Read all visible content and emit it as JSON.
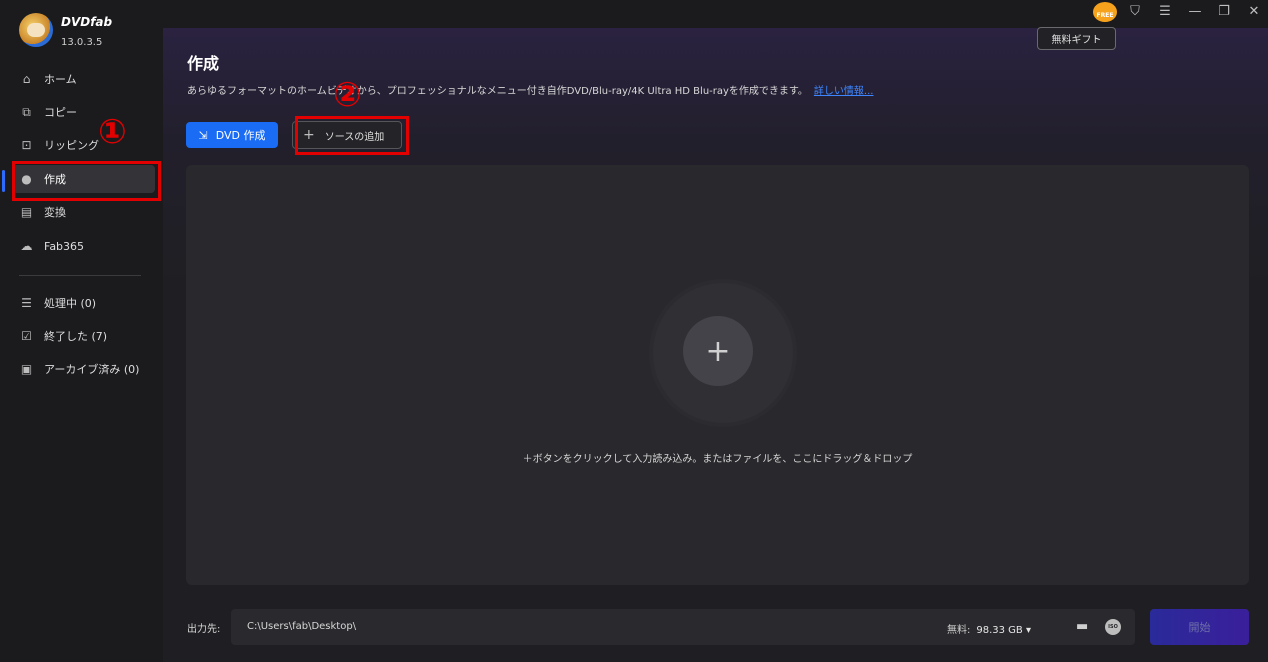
{
  "app": {
    "brand": "DVDfab",
    "version": "13.0.3.5"
  },
  "sidebar": {
    "items": [
      {
        "label": "ホーム",
        "icon": "home-icon"
      },
      {
        "label": "コピー",
        "icon": "copy-icon"
      },
      {
        "label": "リッピング",
        "icon": "ripping-icon"
      },
      {
        "label": "作成",
        "icon": "disc-icon",
        "active": true
      },
      {
        "label": "変換",
        "icon": "film-icon"
      },
      {
        "label": "Fab365",
        "icon": "cloud-icon"
      }
    ],
    "queue": [
      {
        "label": "処理中 (0)",
        "icon": "list-icon"
      },
      {
        "label": "終了した (7)",
        "icon": "check-calendar-icon"
      },
      {
        "label": "アーカイブ済み (0)",
        "icon": "archive-icon"
      }
    ]
  },
  "topbar": {
    "free_badge": "FREE",
    "gift_label": "無料ギフト"
  },
  "main": {
    "title": "作成",
    "description": "あらゆるフォーマットのホームビデオから、プロフェッショナルなメニュー付き自作DVD/Blu-ray/4K Ultra HD Blu-rayを作成できます。",
    "link": "詳しい情報...",
    "dvd_button": "DVD 作成",
    "add_source_button": "ソースの追加",
    "drop_hint": "＋ボタンをクリックして入力読み込み。またはファイルを、ここにドラッグ＆ドロップ"
  },
  "bottom": {
    "output_label": "出力先:",
    "output_path": "C:\\Users\\fab\\Desktop\\",
    "free_label": "無料:",
    "free_value": "98.33 GB ▾",
    "iso_label": "ISO",
    "start_button": "開始"
  },
  "annotations": {
    "one": "①",
    "two": "②"
  },
  "colors": {
    "accent": "#1a6cf5",
    "highlight": "#e30000",
    "link": "#3d86ff"
  }
}
